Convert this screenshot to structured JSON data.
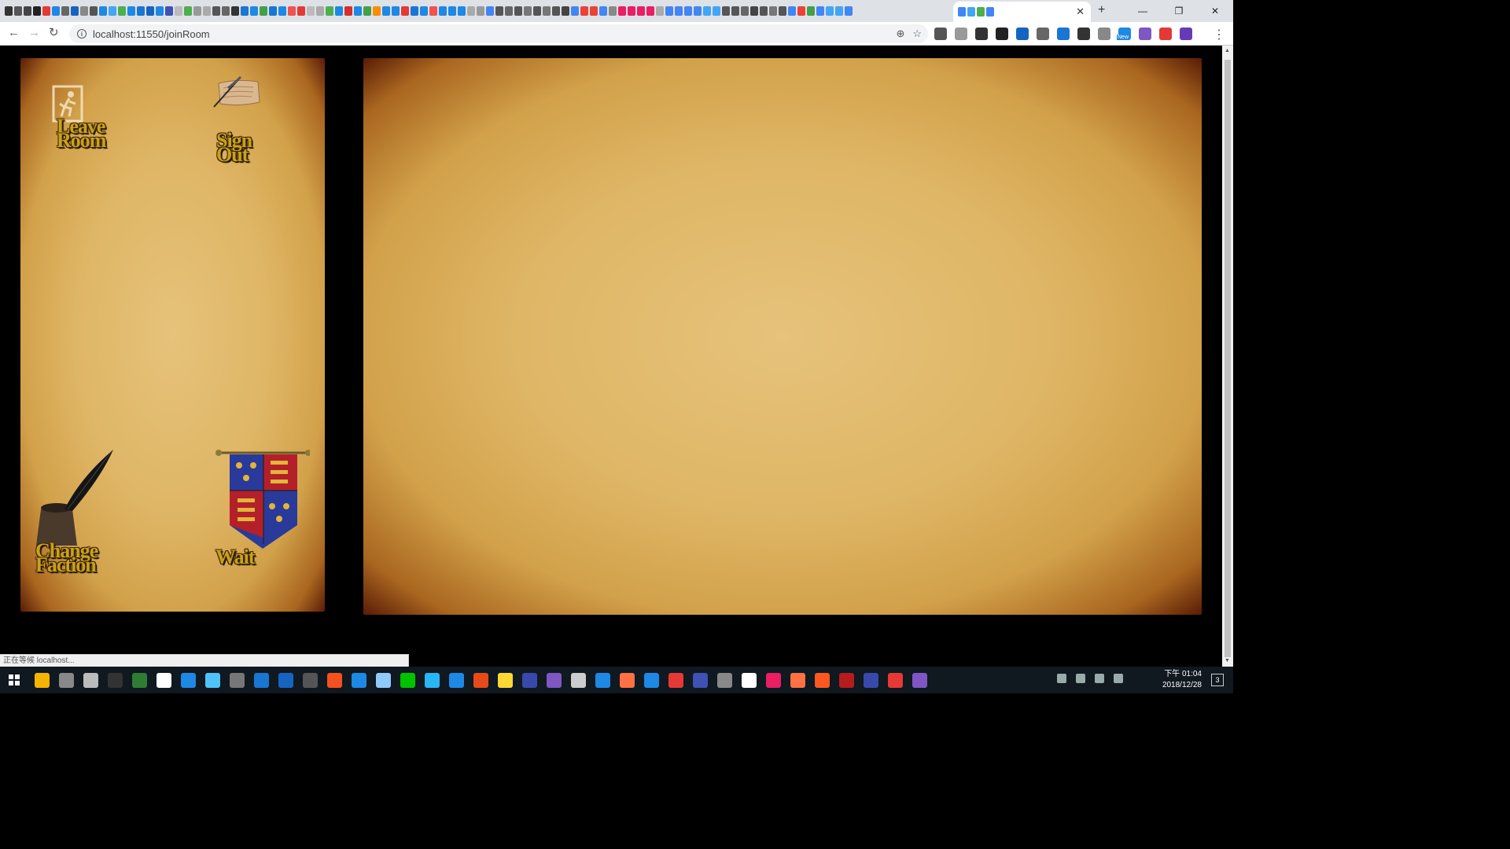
{
  "browser": {
    "url": "localhost:11550/joinRoom",
    "status_text": "正在等候 localhost...",
    "tab_favicon_colors": [
      "#333",
      "#555",
      "#444",
      "#222",
      "#e53935",
      "#1e88e5",
      "#666",
      "#1565c0",
      "#888",
      "#555",
      "#1e88e5",
      "#42a5f5",
      "#4caf50",
      "#1e88e5",
      "#1976d2",
      "#1565c0",
      "#1e88e5",
      "#3f51b5",
      "#bbb",
      "#4caf50",
      "#999",
      "#aaa",
      "#555",
      "#666",
      "#333",
      "#1976d2",
      "#1e88e5",
      "#43a047",
      "#1976d2",
      "#1e88e5",
      "#ef5350",
      "#e53935",
      "#bbb",
      "#aaa",
      "#4caf50",
      "#1e88e5",
      "#d32f2f",
      "#1e88e5",
      "#43a047",
      "#fb8c00",
      "#1e88e5",
      "#1e88e5",
      "#e53935",
      "#1976d2",
      "#1e88e5",
      "#ef5350",
      "#1e88e5",
      "#1e88e5",
      "#1e88e5",
      "#aaa",
      "#999",
      "#4285f4",
      "#555",
      "#666",
      "#555",
      "#777",
      "#555",
      "#777",
      "#555",
      "#444",
      "#4285f4",
      "#ea4335",
      "#ea4335",
      "#4285f4",
      "#888",
      "#e91e63",
      "#e91e63",
      "#e91e63",
      "#e91e63",
      "#aaa",
      "#4285f4",
      "#4285f4",
      "#4285f4",
      "#4285f4",
      "#42a5f5",
      "#42a5f5",
      "#555",
      "#555",
      "#666",
      "#444",
      "#555",
      "#777",
      "#555",
      "#4285f4",
      "#ea4335",
      "#43a047",
      "#4285f4",
      "#42a5f5",
      "#42a5f5",
      "#4285f4"
    ],
    "active_tab_favicon_colors": [
      "#4285f4",
      "#42a5f5",
      "#4caf50",
      "#4285f4"
    ],
    "extension_colors": [
      "#555",
      "#999",
      "#333",
      "#222",
      "#1565c0",
      "#666",
      "#1976d2",
      "#333",
      "#888",
      "#1e88e5",
      "#7e57c2",
      "#e53935",
      "#673ab7"
    ],
    "new_badge": "New",
    "window_controls": {
      "minimize": "—",
      "maximize": "❐",
      "close": "✕"
    }
  },
  "game": {
    "left_panel": {
      "items": [
        {
          "id": "leave-room",
          "label": "Leave\nRoom",
          "icon": "exit-icon"
        },
        {
          "id": "sign-out",
          "label": "Sign\nOut",
          "icon": "scroll-quill-icon"
        },
        {
          "id": "change-faction",
          "label": "Change\nFaction",
          "icon": "inkwell-quill-icon"
        },
        {
          "id": "wait",
          "label": "Wait",
          "icon": "heraldic-banner-icon"
        }
      ]
    },
    "right_panel": {
      "content": ""
    },
    "colors": {
      "parchment_light": "#e6c27a",
      "parchment_edge": "#5a1c06",
      "label_gold": "#caa11a",
      "banner_blue": "#2a3a9a",
      "banner_red": "#b4202a",
      "fleur_gold": "#e2b53a"
    }
  },
  "taskbar": {
    "time": "下午 01:04",
    "date": "2018/12/28",
    "app_colors": [
      "#f5b400",
      "#888",
      "#bbb",
      "#333",
      "#2e7d32",
      "#fff",
      "#1e88e5",
      "#4fc3f7",
      "#777",
      "#1976d2",
      "#1565c0",
      "#555",
      "#f4511e",
      "#1e88e5",
      "#90caf9",
      "#00c300",
      "#29b6f6",
      "#1e88e5",
      "#e64a19",
      "#fdd835",
      "#3949ab",
      "#7e57c2",
      "#ccc",
      "#1e88e5",
      "#ff7043",
      "#1e88e5",
      "#e53935",
      "#3f51b5",
      "#888",
      "#fff",
      "#e91e63",
      "#ff7043",
      "#ff5722",
      "#b71c1c",
      "#3949ab",
      "#e53935",
      "#7e57c2"
    ],
    "notification_count": "3"
  }
}
